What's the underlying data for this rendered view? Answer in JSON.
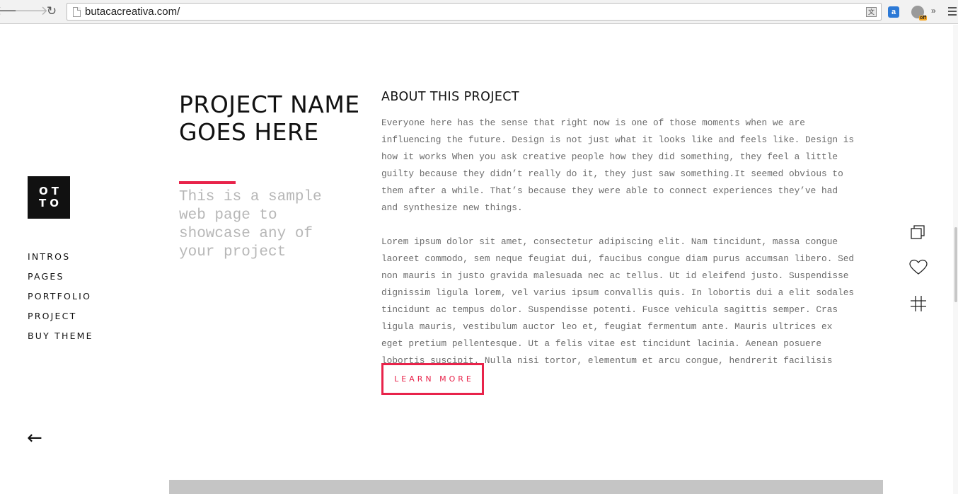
{
  "browser": {
    "url": "butacacreativa.com/",
    "back_glyph": "🡐",
    "forward_glyph": "🡒",
    "reload_glyph": "↻",
    "translate_glyph": "文",
    "ext_1_label": "a",
    "ext_2_badge": "off",
    "more_glyph": "»"
  },
  "sidebar": {
    "logo_line_1": "OT",
    "logo_line_2": "TO",
    "nav": [
      {
        "label": "INTROS"
      },
      {
        "label": "PAGES"
      },
      {
        "label": "PORTFOLIO"
      },
      {
        "label": "PROJECT"
      },
      {
        "label": "BUY THEME"
      }
    ],
    "back_glyph": "←"
  },
  "project": {
    "title": "PROJECT NAME GOES HERE",
    "subtitle": "This is a sample web page to showcase any of your project"
  },
  "about": {
    "heading": "ABOUT THIS PROJECT",
    "paragraph_1": "Everyone here has the sense that right now is one of those moments when we are influencing the future. Design is not just what it looks like and feels like. Design is how it works When you ask creative people how they did something, they feel a little guilty because they didn’t really do it, they just saw something.It seemed obvious to them after a while. That’s because they were able to connect experiences they’ve had and synthesize new things.",
    "paragraph_2": "Lorem ipsum dolor sit amet, consectetur adipiscing elit. Nam tincidunt, massa congue laoreet commodo, sem neque feugiat dui, faucibus congue diam purus accumsan libero. Sed non mauris in justo gravida malesuada nec ac tellus. Ut id eleifend justo. Suspendisse dignissim ligula lorem, vel varius ipsum convallis quis. In lobortis dui a elit sodales tincidunt ac tempus dolor. Suspendisse potenti. Fusce vehicula sagittis semper. Cras ligula mauris, vestibulum auctor leo et, feugiat fermentum ante. Mauris ultrices ex eget pretium pellentesque. Ut a felis vitae est tincidunt lacinia. Aenean posuere lobortis suscipit. Nulla nisi tortor, elementum et arcu congue, hendrerit facilisis leo.",
    "cta_label": "LEARN MORE"
  },
  "actions": {
    "icons": [
      "copy-icon",
      "heart-icon",
      "hashtag-icon"
    ]
  },
  "colors": {
    "accent": "#e8234a",
    "text": "#111111",
    "body_text": "#6b6b6b",
    "subtitle": "#b7b7b7",
    "placeholder_block": "#c5c5c5"
  }
}
